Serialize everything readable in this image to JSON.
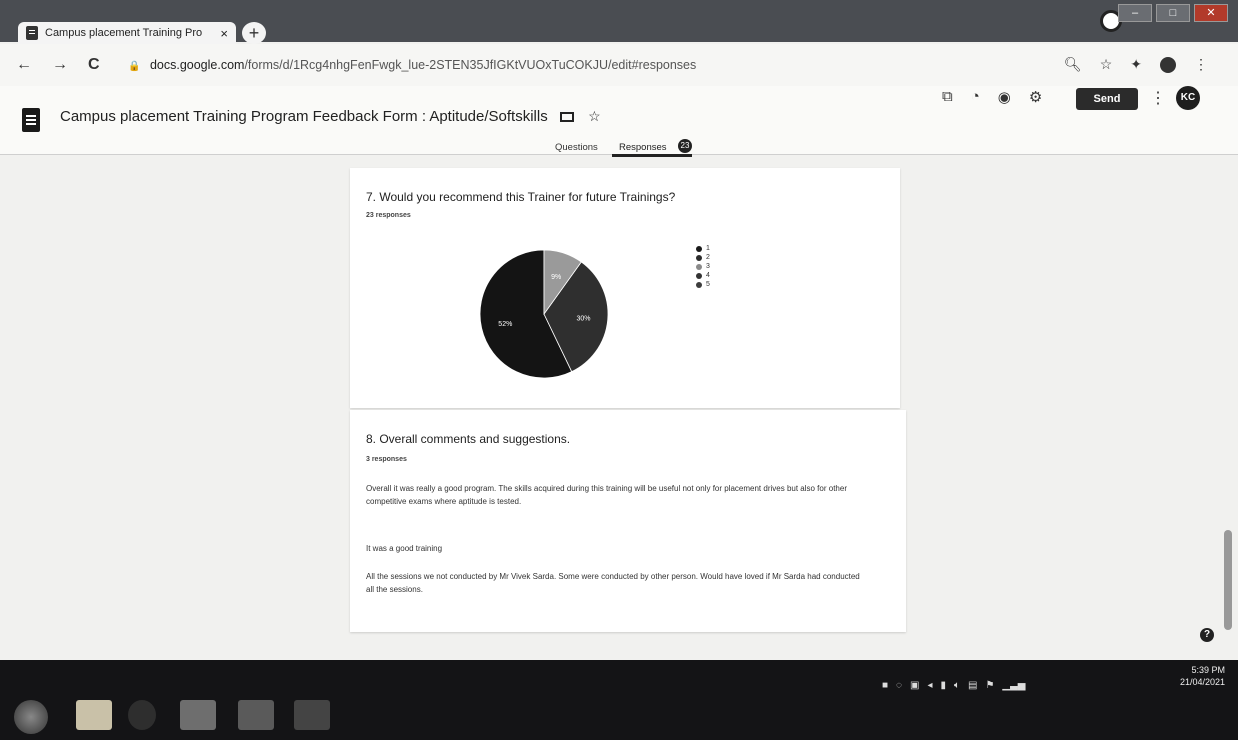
{
  "browser": {
    "tab_title": "Campus placement Training Pro",
    "tab_close": "×",
    "new_tab": "+",
    "url_host": "docs.google.com",
    "url_path": "/forms/d/1Rcg4nhgFenFwgk_lue-2STEN35JfIGKtVUOxTuCOKJU/edit#responses",
    "nav_back": "←",
    "nav_forward": "→",
    "nav_reload": "C"
  },
  "header": {
    "form_title": "Campus placement Training Program  Feedback Form : Aptitude/Softskills",
    "send_label": "Send",
    "avatar_initials": "KC",
    "kebab": "⋮"
  },
  "tabs": {
    "questions_label": "Questions",
    "responses_label": "Responses",
    "responses_count": "23"
  },
  "question7": {
    "title": "7. Would you recommend this Trainer for future Trainings?",
    "response_count": "23 responses",
    "slice_labels": [
      "52%",
      "30%",
      "9%"
    ],
    "legend": [
      "1",
      "2",
      "3",
      "4",
      "5"
    ],
    "legend_colors": [
      "#1a1a1a",
      "#2c2c2c",
      "#8a8a8a",
      "#333333",
      "#3d3d3d"
    ]
  },
  "chart_data": {
    "type": "pie",
    "title": "7. Would you recommend this Trainer for future Trainings?",
    "categories": [
      "1",
      "2",
      "3",
      "4",
      "5"
    ],
    "values": [
      0,
      0,
      9,
      30,
      52
    ],
    "labels": [
      "",
      "",
      "9%",
      "30%",
      "52%"
    ],
    "legend_position": "right"
  },
  "question8": {
    "title": "8. Overall comments and suggestions.",
    "response_count": "3 responses",
    "comments": [
      "Overall it was really a good program. The skills acquired during this training will be useful not only for placement drives but also for other competitive exams where aptitude is tested.",
      "It was a good training",
      "All the sessions we not conducted by Mr Vivek Sarda. Some were conducted by other person. Would have loved if Mr Sarda had conducted all the sessions."
    ]
  },
  "taskbar": {
    "time": "5:39 PM",
    "date": "21/04/2021"
  }
}
